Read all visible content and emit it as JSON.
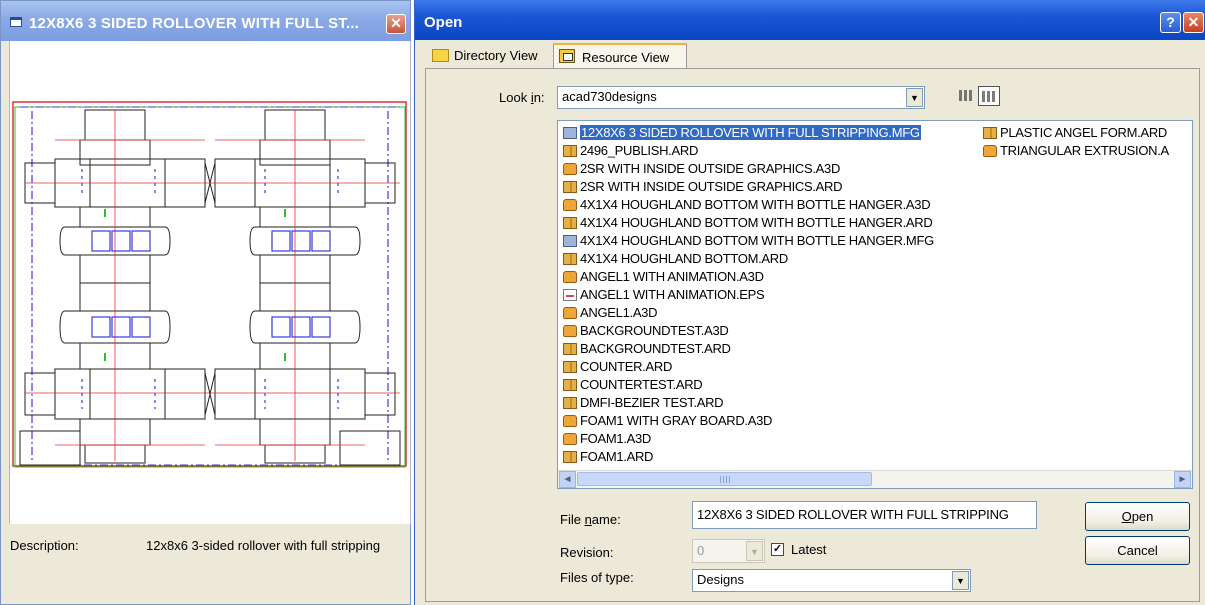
{
  "preview_window": {
    "title": "12X8X6 3 SIDED ROLLOVER WITH FULL ST...",
    "close_glyph": "✕",
    "description_label": "Description:",
    "description_value": "12x8x6 3-sided rollover with full stripping"
  },
  "open_dialog": {
    "title": "Open",
    "help_glyph": "?",
    "close_glyph": "✕",
    "tabs": [
      {
        "label": "Directory View",
        "icon": "folder-icon",
        "active": false
      },
      {
        "label": "Resource View",
        "icon": "resource-icon",
        "active": true
      }
    ],
    "look_in": {
      "label": "Look in:",
      "label_mnemonic": "i",
      "value": "acad730designs",
      "arrow": "▼"
    },
    "files_col1": [
      {
        "name": "12X8X6 3 SIDED ROLLOVER WITH FULL STRIPPING.MFG",
        "type": "mfg",
        "selected": true
      },
      {
        "name": "2496_PUBLISH.ARD",
        "type": "ard"
      },
      {
        "name": "2SR WITH INSIDE OUTSIDE GRAPHICS.A3D",
        "type": "a3d"
      },
      {
        "name": "2SR WITH INSIDE OUTSIDE GRAPHICS.ARD",
        "type": "ard"
      },
      {
        "name": "4X1X4 HOUGHLAND BOTTOM WITH BOTTLE HANGER.A3D",
        "type": "a3d"
      },
      {
        "name": "4X1X4 HOUGHLAND BOTTOM WITH BOTTLE HANGER.ARD",
        "type": "ard"
      },
      {
        "name": "4X1X4 HOUGHLAND BOTTOM WITH BOTTLE HANGER.MFG",
        "type": "mfg"
      },
      {
        "name": "4X1X4 HOUGHLAND BOTTOM.ARD",
        "type": "ard"
      },
      {
        "name": "ANGEL1 WITH ANIMATION.A3D",
        "type": "a3d"
      },
      {
        "name": "ANGEL1 WITH ANIMATION.EPS",
        "type": "eps"
      },
      {
        "name": "ANGEL1.A3D",
        "type": "a3d"
      },
      {
        "name": "BACKGROUNDTEST.A3D",
        "type": "a3d"
      },
      {
        "name": "BACKGROUNDTEST.ARD",
        "type": "ard"
      },
      {
        "name": "COUNTER.ARD",
        "type": "ard"
      },
      {
        "name": "COUNTERTEST.ARD",
        "type": "ard"
      },
      {
        "name": "DMFI-BEZIER TEST.ARD",
        "type": "ard"
      },
      {
        "name": "FOAM1 WITH GRAY BOARD.A3D",
        "type": "a3d"
      },
      {
        "name": "FOAM1.A3D",
        "type": "a3d"
      },
      {
        "name": "FOAM1.ARD",
        "type": "ard"
      }
    ],
    "files_col2": [
      {
        "name": "PLASTIC ANGEL FORM.ARD",
        "type": "ard"
      },
      {
        "name": "TRIANGULAR EXTRUSION.A",
        "type": "a3d"
      }
    ],
    "scroll_left_glyph": "◄",
    "scroll_right_glyph": "►",
    "file_name": {
      "label": "File name:",
      "label_mnemonic": "n",
      "value": "12X8X6 3 SIDED ROLLOVER WITH FULL STRIPPING"
    },
    "revision": {
      "label": "Revision:",
      "value": "0",
      "arrow": "▼",
      "latest_label": "Latest",
      "latest_checked": true,
      "check_glyph": "✓"
    },
    "files_of_type": {
      "label": "Files of type:",
      "value": "Designs",
      "arrow": "▼"
    },
    "buttons": {
      "open": "Open",
      "cancel": "Cancel"
    }
  },
  "colors": {
    "title_bar_active": "#0a46c2",
    "title_bar_inactive": "#8aa9e6",
    "selection": "#316ac5",
    "dialog_face": "#ece9d8"
  }
}
